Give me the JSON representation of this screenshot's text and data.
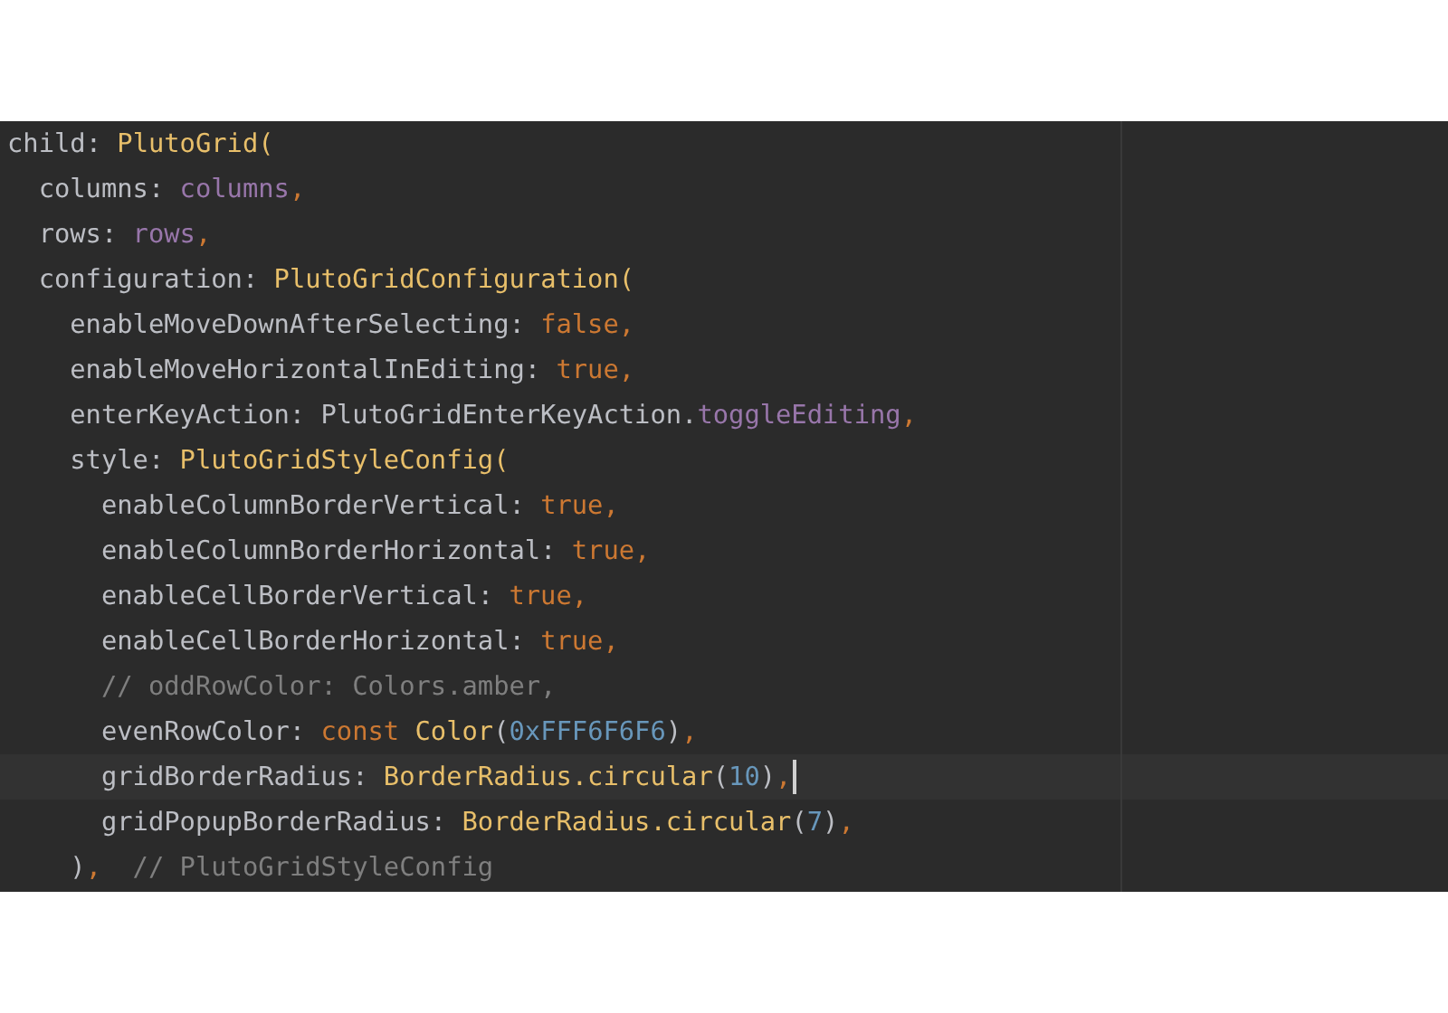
{
  "editor": {
    "lines": [
      {
        "current": false,
        "tokens": [
          {
            "kind": "plain",
            "text": "child: "
          },
          {
            "kind": "class",
            "text": "PlutoGrid("
          }
        ],
        "children": [
          {
            "current": false,
            "tokens": [
              {
                "kind": "plain",
                "text": "columns: "
              },
              {
                "kind": "field",
                "text": "columns"
              },
              {
                "kind": "keyword",
                "text": ","
              }
            ]
          },
          {
            "current": false,
            "tokens": [
              {
                "kind": "plain",
                "text": "rows: "
              },
              {
                "kind": "field",
                "text": "rows"
              },
              {
                "kind": "keyword",
                "text": ","
              }
            ]
          },
          {
            "current": false,
            "tokens": [
              {
                "kind": "plain",
                "text": "configuration: "
              },
              {
                "kind": "class",
                "text": "PlutoGridConfiguration("
              }
            ],
            "children": [
              {
                "current": false,
                "tokens": [
                  {
                    "kind": "plain",
                    "text": "enableMoveDownAfterSelecting: "
                  },
                  {
                    "kind": "keyword",
                    "text": "false,"
                  }
                ]
              },
              {
                "current": false,
                "tokens": [
                  {
                    "kind": "plain",
                    "text": "enableMoveHorizontalInEditing: "
                  },
                  {
                    "kind": "keyword",
                    "text": "true,"
                  }
                ]
              },
              {
                "current": false,
                "tokens": [
                  {
                    "kind": "plain",
                    "text": "enterKeyAction: PlutoGridEnterKeyAction."
                  },
                  {
                    "kind": "field",
                    "text": "toggleEditing"
                  },
                  {
                    "kind": "keyword",
                    "text": ","
                  }
                ]
              },
              {
                "current": false,
                "tokens": [
                  {
                    "kind": "plain",
                    "text": "style: "
                  },
                  {
                    "kind": "class",
                    "text": "PlutoGridStyleConfig("
                  }
                ],
                "children": [
                  {
                    "current": false,
                    "tokens": [
                      {
                        "kind": "plain",
                        "text": "enableColumnBorderVertical: "
                      },
                      {
                        "kind": "keyword",
                        "text": "true,"
                      }
                    ]
                  },
                  {
                    "current": false,
                    "tokens": [
                      {
                        "kind": "plain",
                        "text": "enableColumnBorderHorizontal: "
                      },
                      {
                        "kind": "keyword",
                        "text": "true,"
                      }
                    ]
                  },
                  {
                    "current": false,
                    "tokens": [
                      {
                        "kind": "plain",
                        "text": "enableCellBorderVertical: "
                      },
                      {
                        "kind": "keyword",
                        "text": "true,"
                      }
                    ]
                  },
                  {
                    "current": false,
                    "tokens": [
                      {
                        "kind": "plain",
                        "text": "enableCellBorderHorizontal: "
                      },
                      {
                        "kind": "keyword",
                        "text": "true,"
                      }
                    ]
                  },
                  {
                    "current": false,
                    "tokens": [
                      {
                        "kind": "comment",
                        "text": "// oddRowColor: Colors.amber,"
                      }
                    ]
                  },
                  {
                    "current": false,
                    "tokens": [
                      {
                        "kind": "plain",
                        "text": "evenRowColor: "
                      },
                      {
                        "kind": "keyword",
                        "text": "const "
                      },
                      {
                        "kind": "class",
                        "text": "Color"
                      },
                      {
                        "kind": "plain",
                        "text": "("
                      },
                      {
                        "kind": "number",
                        "text": "0xFFF6F6F6"
                      },
                      {
                        "kind": "plain",
                        "text": ")"
                      },
                      {
                        "kind": "keyword",
                        "text": ","
                      }
                    ]
                  },
                  {
                    "current": true,
                    "tokens": [
                      {
                        "kind": "plain",
                        "text": "gridBorderRadius: "
                      },
                      {
                        "kind": "class",
                        "text": "BorderRadius.circular"
                      },
                      {
                        "kind": "plain",
                        "text": "("
                      },
                      {
                        "kind": "number",
                        "text": "10"
                      },
                      {
                        "kind": "plain",
                        "text": ")"
                      },
                      {
                        "kind": "keyword",
                        "text": ","
                      }
                    ]
                  },
                  {
                    "current": false,
                    "tokens": [
                      {
                        "kind": "plain",
                        "text": "gridPopupBorderRadius: "
                      },
                      {
                        "kind": "class",
                        "text": "BorderRadius.circular"
                      },
                      {
                        "kind": "plain",
                        "text": "("
                      },
                      {
                        "kind": "number",
                        "text": "7"
                      },
                      {
                        "kind": "plain",
                        "text": ")"
                      },
                      {
                        "kind": "keyword",
                        "text": ","
                      }
                    ]
                  }
                ]
              },
              {
                "current": false,
                "tokens": [
                  {
                    "kind": "plain",
                    "text": ")"
                  },
                  {
                    "kind": "keyword",
                    "text": ","
                  },
                  {
                    "kind": "comment",
                    "text": "  // PlutoGridStyleConfig"
                  }
                ]
              }
            ]
          }
        ]
      }
    ]
  }
}
